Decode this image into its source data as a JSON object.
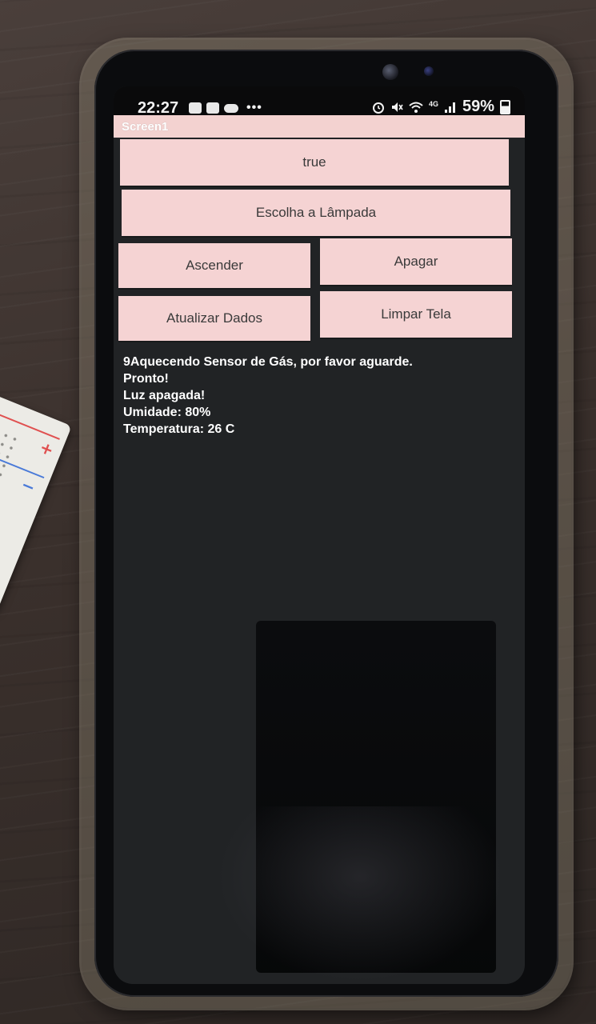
{
  "status_bar": {
    "time": "22:27",
    "network": "4G",
    "battery": "59%",
    "battery_level": 0.59,
    "left_icons": [
      "notification-card-icon",
      "p-app-icon",
      "cloud-icon"
    ],
    "overflow_indicator": "•••",
    "right_icons": [
      "alarm-icon",
      "mute-icon",
      "wifi-icon",
      "signal-icon",
      "battery-icon"
    ]
  },
  "app": {
    "title": "Screen1",
    "title_bar_color": "#f3d2d0",
    "button_color": "#f5d3d3",
    "background_color": "#212325"
  },
  "buttons": {
    "status": "true",
    "choose_lamp": "Escolha a Lâmpada",
    "turn_on": "Ascender",
    "turn_off": "Apagar",
    "update_data": "Atualizar Dados",
    "clear_screen": "Limpar Tela"
  },
  "log": {
    "lines": [
      "9Aquecendo Sensor de Gás, por favor aguarde.",
      "Pronto!",
      "Luz apagada!",
      "Umidade: 80%",
      "Temperatura: 26 C"
    ]
  }
}
